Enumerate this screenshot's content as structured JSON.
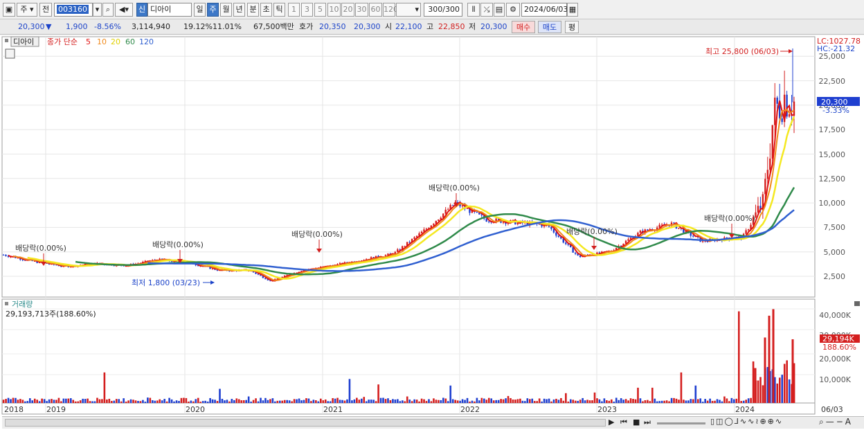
{
  "toolbar": {
    "period_label": "주",
    "prev_label": "전",
    "stock_code": "003160",
    "badge": "신",
    "stock_name": "디아이",
    "period_tabs": [
      "일",
      "주",
      "월",
      "년",
      "분",
      "초",
      "틱"
    ],
    "selected_period": "주",
    "interval_buttons": [
      "1",
      "3",
      "5",
      "10",
      "20",
      "30",
      "60",
      "120"
    ],
    "count_display": "300/300",
    "date": "2024/06/03"
  },
  "quote": {
    "price": "20,300",
    "change_arrow": "▼",
    "change": "1,900",
    "change_pct": "-8.56%",
    "volume": "3,114,940",
    "turnover_pct": "19.12%",
    "ratio_pct": "11.01%",
    "amount": "67,500백만",
    "bid_label": "호가",
    "bid1": "20,350",
    "bid2": "20,300",
    "open_label": "시",
    "open": "22,100",
    "high_label": "고",
    "high": "22,850",
    "low_label": "저",
    "low": "20,300",
    "buy_label": "매수",
    "sell_label": "매도",
    "eval_label": "평"
  },
  "colors": {
    "up": "#d41e1e",
    "down": "#1f3fd0",
    "ma5": "#e01010",
    "ma10": "#f08a1c",
    "ma20": "#f4e820",
    "ma60": "#2f8a4a",
    "ma120": "#2f5fd0"
  },
  "chart_data": [
    {
      "type": "candlestick",
      "title": "디아이",
      "legend_prefix": "종가 단순",
      "legend": [
        "5",
        "10",
        "20",
        "60",
        "120"
      ],
      "ylim": [
        0,
        27000
      ],
      "y_ticks": [
        "2,500",
        "5,000",
        "7,500",
        "10,000",
        "12,500",
        "15,000",
        "17,500",
        "20,000",
        "22,500",
        "25,000"
      ],
      "x_ticks": [
        "2018",
        "2019",
        "2020",
        "2021",
        "2022",
        "2023",
        "2024",
        "06/03"
      ],
      "lc_label": "LC:1027.78",
      "hc_label": "HC:-21.32",
      "last_price_label": "20,300",
      "last_change_label": "-3.33%",
      "high_note": "최고 25,800 (06/03)",
      "low_note": "최저 1,800 (03/23)",
      "dividend_notes": [
        "배당락(0.00%)",
        "배당락(0.00%)",
        "배당락(0.00%)",
        "배당락(0.00%)",
        "배당락(0.00%)",
        "배당락(0.00%)"
      ],
      "close_path": [
        [
          "2018-01",
          4700
        ],
        [
          "2018-04",
          4000
        ],
        [
          "2018-07",
          3500
        ],
        [
          "2018-10",
          3800
        ],
        [
          "2019-01",
          3600
        ],
        [
          "2019-04",
          4200
        ],
        [
          "2019-07",
          3900
        ],
        [
          "2019-10",
          3100
        ],
        [
          "2020-01",
          3100
        ],
        [
          "2020-03",
          2000
        ],
        [
          "2020-06",
          3100
        ],
        [
          "2020-09",
          3600
        ],
        [
          "2020-12",
          4200
        ],
        [
          "2021-03",
          4800
        ],
        [
          "2021-06",
          7200
        ],
        [
          "2021-09",
          10000
        ],
        [
          "2021-12",
          8300
        ],
        [
          "2022-03",
          8000
        ],
        [
          "2022-06",
          7700
        ],
        [
          "2022-09",
          4500
        ],
        [
          "2022-12",
          5000
        ],
        [
          "2023-03",
          7000
        ],
        [
          "2023-06",
          7900
        ],
        [
          "2023-09",
          6100
        ],
        [
          "2024-01",
          6500
        ],
        [
          "2024-03",
          10000
        ],
        [
          "2024-04",
          19000
        ],
        [
          "2024-05",
          21000
        ],
        [
          "2024-06",
          20300
        ]
      ]
    },
    {
      "type": "bar",
      "title": "거래량",
      "summary_label": "29,193,713주(188.60%)",
      "y_ticks": [
        "10,000K",
        "20,000K",
        "30,000K",
        "40,000K"
      ],
      "ylim": [
        0,
        46000
      ],
      "last_volume_label": "29,194K",
      "last_pct_label": "188.60%",
      "values_k": [
        1500,
        1200,
        900,
        800,
        700,
        900,
        14000,
        1800,
        1500,
        2500,
        1200,
        1100,
        1000,
        6500,
        1300,
        3000,
        1200,
        1000,
        800,
        2200,
        2000,
        11000,
        2800,
        8500,
        1800,
        3000,
        2000,
        1500,
        8000,
        1400,
        1200,
        3200,
        1000,
        900,
        700,
        4500,
        1500,
        4800,
        1000,
        1500,
        7000,
        1200,
        14000,
        8000,
        2000,
        3000,
        42000,
        4000,
        15000,
        29194
      ]
    }
  ]
}
